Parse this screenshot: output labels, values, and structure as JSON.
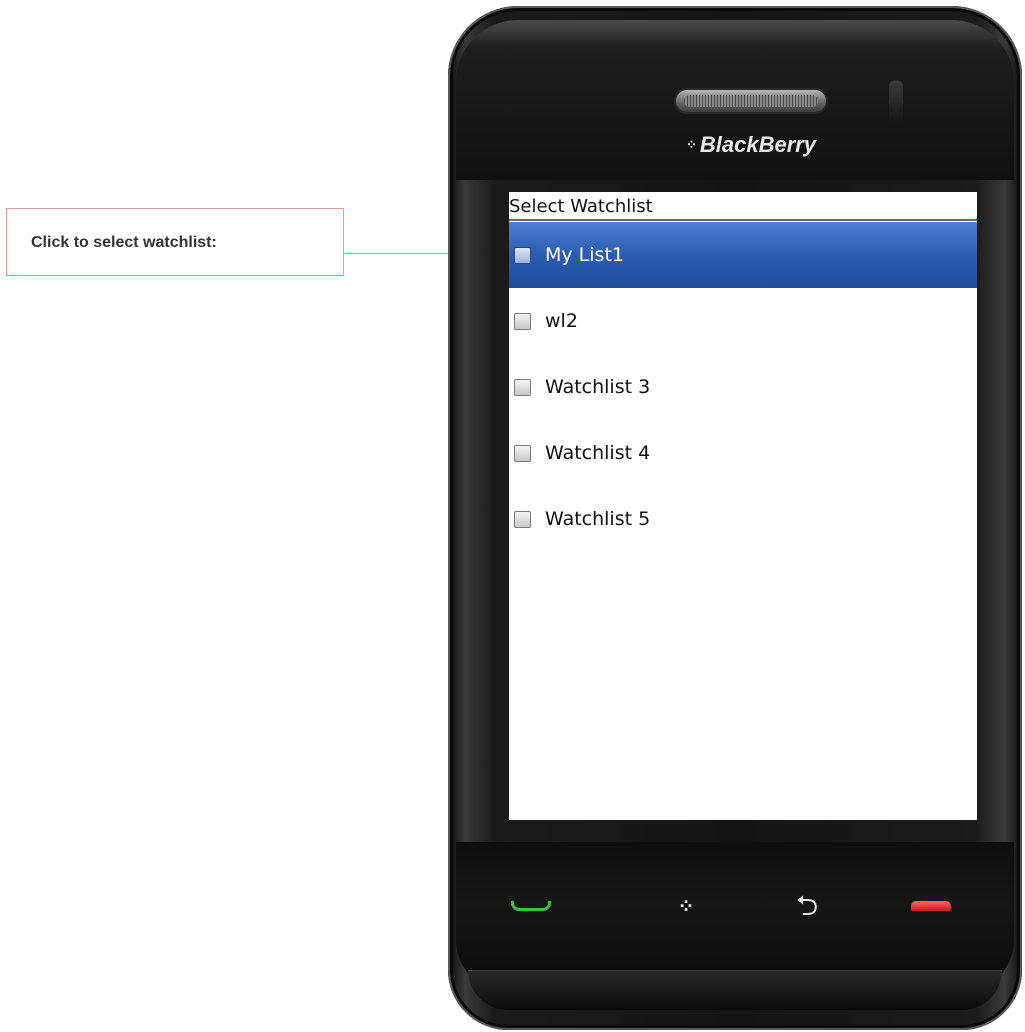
{
  "callout": {
    "text": "Click to select watchlist:"
  },
  "device": {
    "brand": "BlackBerry"
  },
  "screen": {
    "title": "Select Watchlist",
    "items": [
      {
        "label": "My List1",
        "selected": true,
        "checked": false
      },
      {
        "label": "wl2",
        "selected": false,
        "checked": false
      },
      {
        "label": "Watchlist 3",
        "selected": false,
        "checked": false
      },
      {
        "label": "Watchlist 4",
        "selected": false,
        "checked": false
      },
      {
        "label": "Watchlist 5",
        "selected": false,
        "checked": false
      }
    ]
  },
  "keys": [
    {
      "name": "call-key",
      "icon": "call-icon"
    },
    {
      "name": "menu-key",
      "icon": "blackberry-logo-icon"
    },
    {
      "name": "back-key",
      "icon": "back-arrow-icon"
    },
    {
      "name": "end-key",
      "icon": "end-call-icon"
    }
  ],
  "colors": {
    "selection": "#2a5cb0",
    "callout_border": "#e69a9a",
    "call_green": "#37c04a",
    "end_red": "#c21a1a"
  }
}
